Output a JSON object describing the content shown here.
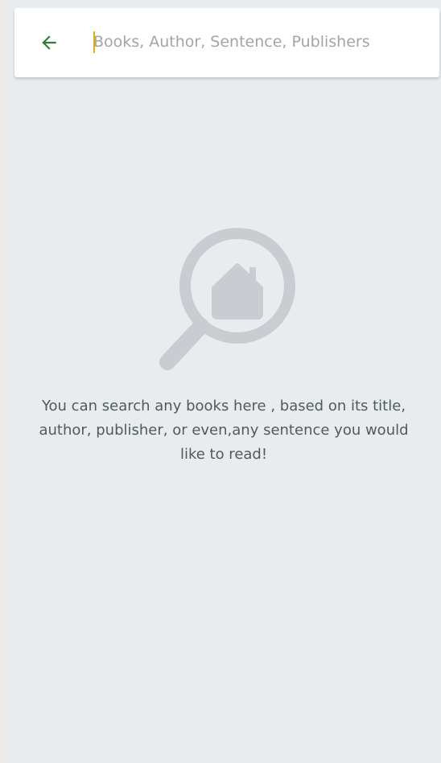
{
  "search": {
    "placeholder": "Books, Author, Sentence, Publishers",
    "value": ""
  },
  "icons": {
    "back": "arrow-left-icon",
    "empty_state": "magnifier-house-icon"
  },
  "colors": {
    "back_arrow": "#2e7d32",
    "caret": "#e2b200",
    "illustration": "#c9cdd1",
    "message_text": "#505a5c",
    "background": "#e9ecef"
  },
  "empty_state": {
    "message": "You can search any books here , based on its title, author, publisher, or even,any sentence you would like to read!"
  }
}
